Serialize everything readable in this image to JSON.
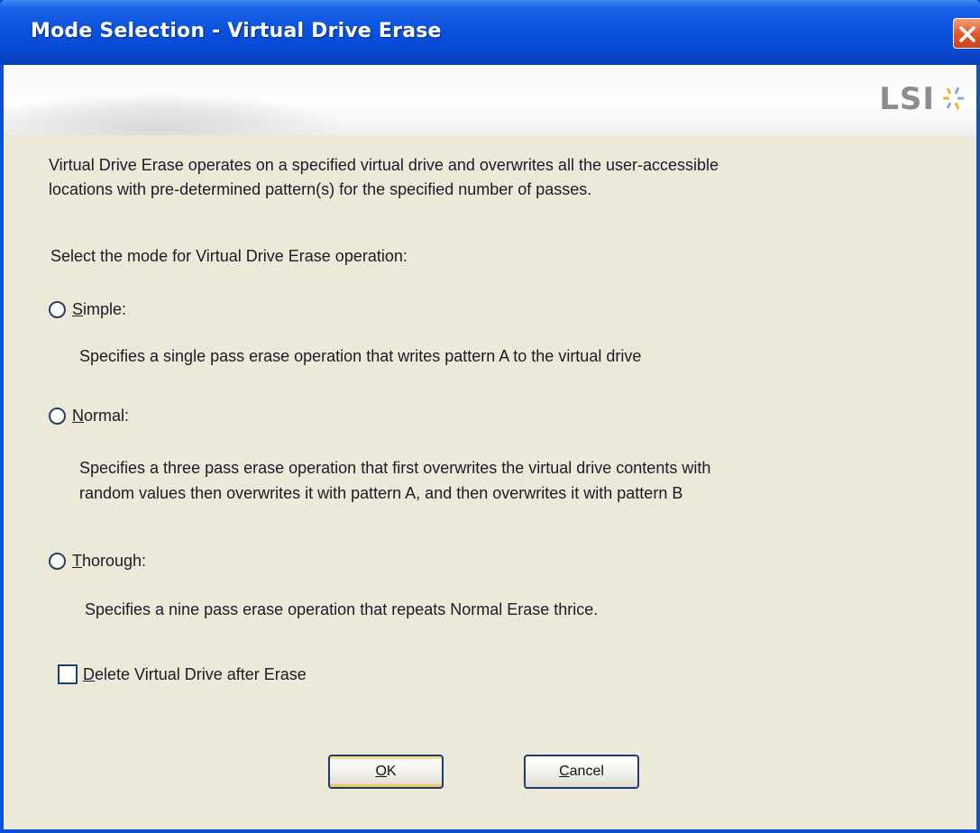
{
  "window": {
    "title": "Mode Selection - Virtual Drive Erase",
    "logo_text": "LSI",
    "colors": {
      "titlebar": "#0a52de",
      "background": "#ece9d8",
      "close_button": "#e05a2c"
    }
  },
  "description": {
    "line1": "Virtual Drive Erase operates on a specified virtual drive and overwrites all the user-accessible",
    "line2": "locations with pre-determined pattern(s) for the specified number of passes."
  },
  "prompt": "Select the mode for Virtual Drive Erase operation:",
  "modes": [
    {
      "accel": "S",
      "label_rest": "imple:",
      "selected": false,
      "description": "Specifies a single pass erase operation that writes pattern A to the virtual drive"
    },
    {
      "accel": "N",
      "label_rest": "ormal:",
      "selected": false,
      "description_line1": "Specifies a three pass erase operation that first overwrites the virtual drive contents with",
      "description_line2": "random values then overwrites it with pattern A, and then overwrites it with pattern B"
    },
    {
      "accel": "T",
      "label_rest": "horough:",
      "selected": false,
      "description": "Specifies a nine pass erase operation that repeats Normal Erase thrice."
    }
  ],
  "delete_option": {
    "accel": "D",
    "label_rest": "elete Virtual Drive after Erase",
    "checked": false
  },
  "buttons": {
    "ok_accel": "O",
    "ok_rest": "K",
    "cancel_accel": "C",
    "cancel_rest": "ancel"
  },
  "icons": {
    "close": "close-x-icon",
    "logo_mark": "lsi-starburst-icon"
  }
}
